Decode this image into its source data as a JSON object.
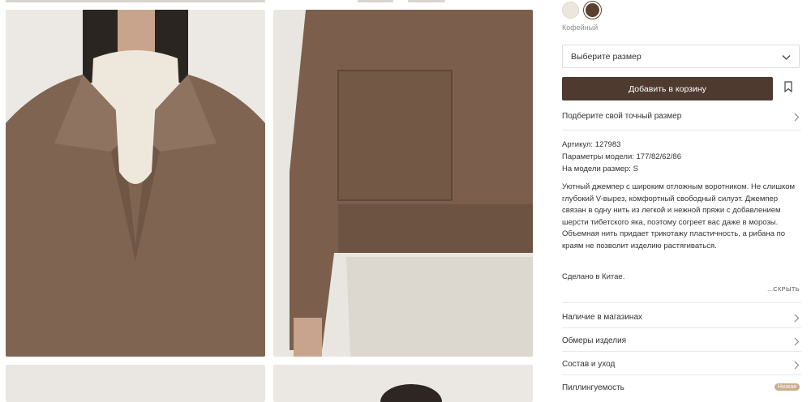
{
  "product": {
    "color_name": "Кофейный",
    "swatches": [
      "светлый",
      "кофейный"
    ],
    "size_placeholder": "Выберите размер",
    "add_to_cart": "Добавить в корзину",
    "size_guide": "Подберите свой точный размер",
    "article": "Артикул: 127983",
    "model_params": "Параметры модели: 177/82/62/86",
    "model_size": "На модели размер: S",
    "description": "Уютный джемпер с широким отложным воротником. Не слишком глубокий V-вырез, комфортный свободный силуэт. Джемпер связан в одну нить из легкой и нежной пряжи с добавлением шерсти тибетского яка, поэтому согреет вас даже в морозы. Объемная нить придает трикотажу пластичность, а рибана по краям не позволит изделию растягиваться.",
    "made_in": "Сделано в Китае.",
    "hide_label": "...СКРЫТЬ"
  },
  "sections": {
    "availability": "Наличие в магазинах",
    "measurements": "Обмеры изделия",
    "composition": "Состав и уход",
    "pilling": "Пиллингуемость",
    "pilling_badge": "Низкая"
  },
  "colors": {
    "button": "#4e3a2f",
    "swatch_dark": "#5b4132",
    "swatch_light": "#ece7dc",
    "sweater": "#7f6452",
    "badge": "#c9ae8d"
  },
  "icons": [
    "chevron-down-icon",
    "bookmark-icon",
    "chevron-right-icon"
  ]
}
